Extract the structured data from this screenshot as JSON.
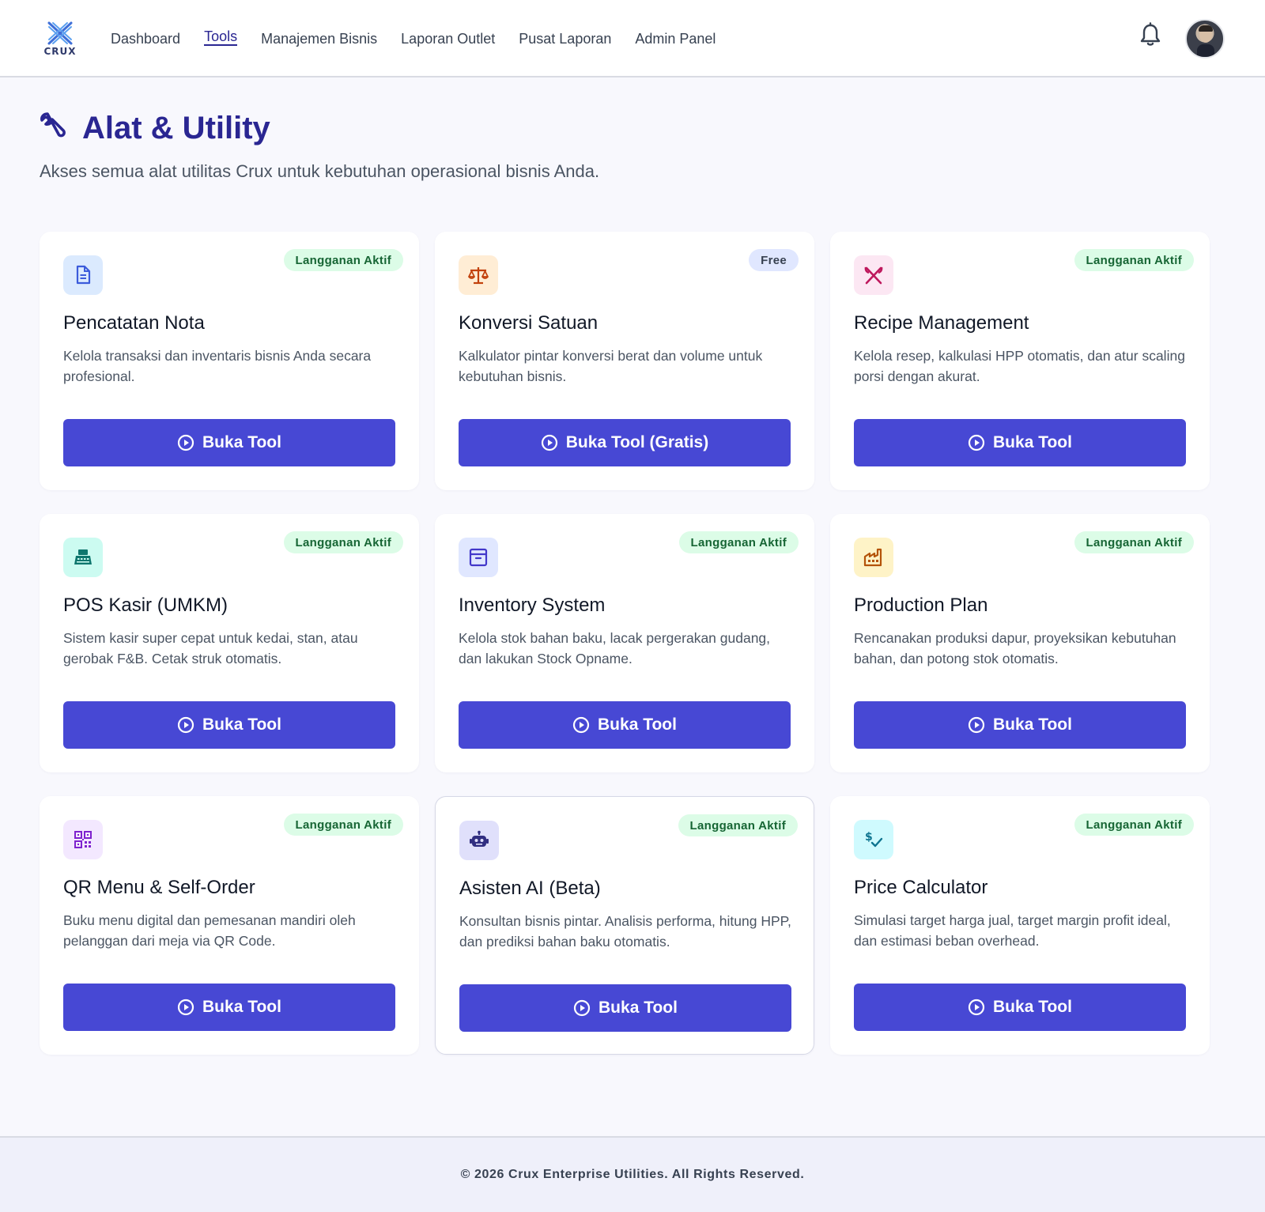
{
  "header": {
    "logo_text": "CRUX",
    "nav": [
      {
        "label": "Dashboard",
        "active": false
      },
      {
        "label": "Tools",
        "active": true
      },
      {
        "label": "Manajemen Bisnis",
        "active": false
      },
      {
        "label": "Laporan Outlet",
        "active": false
      },
      {
        "label": "Pusat Laporan",
        "active": false
      },
      {
        "label": "Admin Panel",
        "active": false
      }
    ],
    "icons": [
      "bell-icon",
      "user-avatar"
    ]
  },
  "page": {
    "title": "Alat & Utility",
    "title_icon": "wrench-icon",
    "subtitle": "Akses semua alat utilitas Crux untuk kebutuhan operasional bisnis Anda."
  },
  "cards": [
    {
      "title": "Pencatatan Nota",
      "desc": "Kelola transaksi dan inventaris bisnis Anda secara profesional.",
      "badge": "Langganan Aktif",
      "badge_type": "active",
      "button": "Buka Tool",
      "icon": "document-icon",
      "icon_bg": "#dbeafe",
      "icon_color": "#3b5bdb"
    },
    {
      "title": "Konversi Satuan",
      "desc": "Kalkulator pintar konversi berat dan volume untuk kebutuhan bisnis.",
      "badge": "Free",
      "badge_type": "free",
      "button": "Buka Tool (Gratis)",
      "icon": "scale-icon",
      "icon_bg": "#ffedd5",
      "icon_color": "#c2410c"
    },
    {
      "title": "Recipe Management",
      "desc": "Kelola resep, kalkulasi HPP otomatis, dan atur scaling porsi dengan akurat.",
      "badge": "Langganan Aktif",
      "badge_type": "active",
      "button": "Buka Tool",
      "icon": "utensils-icon",
      "icon_bg": "#fce7f3",
      "icon_color": "#be185d"
    },
    {
      "title": "POS Kasir (UMKM)",
      "desc": "Sistem kasir super cepat untuk kedai, stan, atau gerobak F&B. Cetak struk otomatis.",
      "badge": "Langganan Aktif",
      "badge_type": "active",
      "button": "Buka Tool",
      "icon": "cash-register-icon",
      "icon_bg": "#ccfbf1",
      "icon_color": "#0f766e"
    },
    {
      "title": "Inventory System",
      "desc": "Kelola stok bahan baku, lacak pergerakan gudang, dan lakukan Stock Opname.",
      "badge": "Langganan Aktif",
      "badge_type": "active",
      "button": "Buka Tool",
      "icon": "archive-box-icon",
      "icon_bg": "#e0e7ff",
      "icon_color": "#4338ca"
    },
    {
      "title": "Production Plan",
      "desc": "Rencanakan produksi dapur, proyeksikan kebutuhan bahan, dan potong stok otomatis.",
      "badge": "Langganan Aktif",
      "badge_type": "active",
      "button": "Buka Tool",
      "icon": "factory-icon",
      "icon_bg": "#fef3c7",
      "icon_color": "#b45309"
    },
    {
      "title": "QR Menu & Self-Order",
      "desc": "Buku menu digital dan pemesanan mandiri oleh pelanggan dari meja via QR Code.",
      "badge": "Langganan Aktif",
      "badge_type": "active",
      "button": "Buka Tool",
      "icon": "qr-code-icon",
      "icon_bg": "#f3e8ff",
      "icon_color": "#7e22ce"
    },
    {
      "title": "Asisten AI (Beta)",
      "desc": "Konsultan bisnis pintar. Analisis performa, hitung HPP, dan prediksi bahan baku otomatis.",
      "badge": "Langganan Aktif",
      "badge_type": "active",
      "button": "Buka Tool",
      "icon": "robot-icon",
      "icon_bg": "#e0e0fb",
      "icon_color": "#312e81"
    },
    {
      "title": "Price Calculator",
      "desc": "Simulasi target harga jual, target margin profit ideal, dan estimasi beban overhead.",
      "badge": "Langganan Aktif",
      "badge_type": "active",
      "button": "Buka Tool",
      "icon": "dollar-check-icon",
      "icon_bg": "#cffafe",
      "icon_color": "#0e7490"
    }
  ],
  "footer": {
    "text": "© 2026 Crux Enterprise Utilities. All Rights Reserved."
  },
  "colors": {
    "primary": "#4748d4",
    "title": "#2a2692",
    "badge_active_bg": "#dcfce7",
    "badge_active_text": "#166534"
  }
}
